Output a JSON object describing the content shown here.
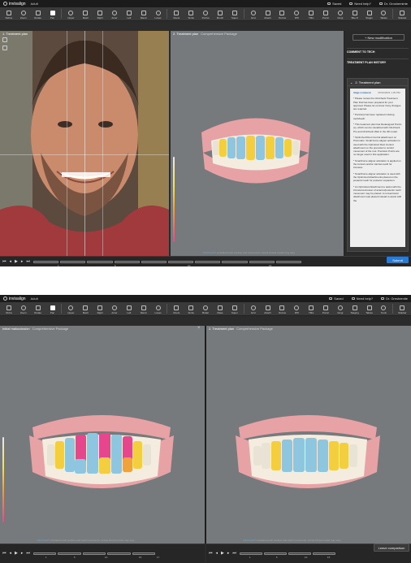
{
  "app": {
    "brand": "invisalign",
    "arch_select": "Adult",
    "saved": "Saved",
    "help": "Need help?",
    "user_short": "Dr. Grosheminte",
    "user_long": "Dr. Greshemite"
  },
  "toolbar1": [
    {
      "label": "Refine",
      "icon": "refine-icon"
    },
    {
      "label": "Zoom",
      "icon": "zoom-icon"
    },
    {
      "label": "Rotate",
      "icon": "rotate-icon"
    },
    {
      "label": "Pan",
      "icon": "pan-icon"
    },
    {
      "label": "Upper",
      "icon": "upper-icon"
    },
    {
      "label": "Maxil",
      "icon": "maxil-icon"
    },
    {
      "label": "Right",
      "icon": "right-icon"
    },
    {
      "label": "Anter",
      "icon": "anterior-icon"
    },
    {
      "label": "Left",
      "icon": "left-icon"
    },
    {
      "label": "Mand",
      "icon": "mand-icon"
    },
    {
      "label": "Lower",
      "icon": "lower-icon"
    },
    {
      "label": "Roots",
      "icon": "roots-icon"
    },
    {
      "label": "Smile",
      "icon": "smile-icon"
    },
    {
      "label": "Portrai",
      "icon": "portrait-icon"
    },
    {
      "label": "Mouth",
      "icon": "mouth-icon"
    },
    {
      "label": "Super",
      "icon": "super-icon"
    },
    {
      "label": "Grid",
      "icon": "grid-icon"
    },
    {
      "label": "Attach",
      "icon": "attach-icon"
    },
    {
      "label": "Occlus",
      "icon": "occlusal-icon"
    },
    {
      "label": "IPR",
      "icon": "ipr-icon"
    },
    {
      "label": "TMA",
      "icon": "tma-icon"
    },
    {
      "label": "Pontic",
      "icon": "pontic-icon"
    },
    {
      "label": "Gingi",
      "icon": "gingiva-icon"
    },
    {
      "label": "Bite R",
      "icon": "bite-ramp-icon"
    },
    {
      "label": "Stagin",
      "icon": "staging-icon"
    },
    {
      "label": "Tables",
      "icon": "tables-icon"
    },
    {
      "label": "Sidebar",
      "icon": "sidebar-icon"
    }
  ],
  "toolbar2": [
    {
      "label": "ShCa",
      "icon": "refine-icon"
    },
    {
      "label": "Zoom",
      "icon": "zoom-icon"
    },
    {
      "label": "Rotate",
      "icon": "rotate-icon"
    },
    {
      "label": "Pan",
      "icon": "pan-icon"
    },
    {
      "label": "Upper",
      "icon": "upper-icon"
    },
    {
      "label": "Maxil",
      "icon": "maxil-icon"
    },
    {
      "label": "Right",
      "icon": "right-icon"
    },
    {
      "label": "Anter",
      "icon": "anterior-icon"
    },
    {
      "label": "Left",
      "icon": "left-icon"
    },
    {
      "label": "Mand",
      "icon": "mand-icon"
    },
    {
      "label": "Lower",
      "icon": "lower-icon"
    },
    {
      "label": "Roots",
      "icon": "roots-icon"
    },
    {
      "label": "Smile",
      "icon": "smile-icon"
    },
    {
      "label": "Buttar",
      "icon": "button-icon"
    },
    {
      "label": "Mass",
      "icon": "mass-icon"
    },
    {
      "label": "Super",
      "icon": "super-icon"
    },
    {
      "label": "Grid",
      "icon": "grid-icon"
    },
    {
      "label": "Attach",
      "icon": "attach-icon"
    },
    {
      "label": "Occlus",
      "icon": "occlusal-icon"
    },
    {
      "label": "IPR",
      "icon": "ipr-icon"
    },
    {
      "label": "TMA",
      "icon": "tma-icon"
    },
    {
      "label": "Pontic",
      "icon": "pontic-icon"
    },
    {
      "label": "Gingi",
      "icon": "gingiva-icon"
    },
    {
      "label": "Staging",
      "icon": "staging-icon"
    },
    {
      "label": "Tables",
      "icon": "tables-icon"
    },
    {
      "label": "Tools",
      "icon": "tools-icon"
    },
    {
      "label": "Sidebar",
      "icon": "sidebar-icon"
    }
  ],
  "shot1": {
    "left_panel_title": "1. Treatment plan",
    "center_panel_title": "2. Treatment plan",
    "center_panel_sub": "Comprehensive Package",
    "status_prefix": "ClinCheck®",
    "status_text": "simulated tooth position and movements. Actual clinical results may vary.",
    "steps": [
      "1",
      "5",
      "10",
      "15"
    ],
    "side": {
      "modify_button": "+ New modification",
      "comment_label": "COMMENT TO TECH",
      "history_label": "TREATMENT PLAN HISTORY",
      "card_title": "2. Treatment plan",
      "comment_author": "Align comment",
      "comment_date": "05/10/2021 1:25 PM",
      "paragraphs": [
        "* Please review the ClinCheck Treatment Plan that has been prepared for your approval. Please let us know if any changes are required.",
        "* Pontic(s) has been replaced missing tooth/teeth.",
        "* This treatment plan has Redesigned Pontic (s), which can be visualized with ClinCheck Pro and ClinCheck Web in the 3D model.",
        "* Optimized Root Control attachment on Premolars. Small Force aligner activation is used with the Optimized Root Control attachment on the premolar to control movement of the root. Precision Points are no longer used in this application.",
        "* SmartForce aligner activation is applied on the incisors and/or canines teeth for intrusion.",
        "* SmartForce aligner activation is used with the Optimized Attachments placed on the posterior teeth for posterior expansion.",
        "* An Optimized Attachment to assist with the intrusion/extrusion of anterior/posterior tooth movement may be placed. A conventional attachment was placed instead to assist with the"
      ],
      "submit": "Submit"
    }
  },
  "shot2": {
    "left_panel_title": "Initial malocclusion",
    "left_panel_sub": "Comprehensive Package",
    "right_panel_title": "2. Treatment plan",
    "right_panel_sub": "Comprehensive Package",
    "status_prefix": "ClinCheck®",
    "status_text": "simulated tooth position and tooth movements. Actual clinical results may vary.",
    "left_steps": [
      "1",
      "5",
      "10",
      "15"
    ],
    "left_end_step": "17",
    "right_steps": [
      "1",
      "5",
      "10",
      "15"
    ],
    "leave_comparison": "Leave comparison"
  },
  "colors": {
    "accent_blue": "#2a7bd3",
    "tooth_blue": "#8ec6df",
    "tooth_yellow": "#f3cf3f",
    "tooth_orange": "#f0a33a",
    "tooth_pink": "#e6468c",
    "gum": "#e7a2a6"
  }
}
